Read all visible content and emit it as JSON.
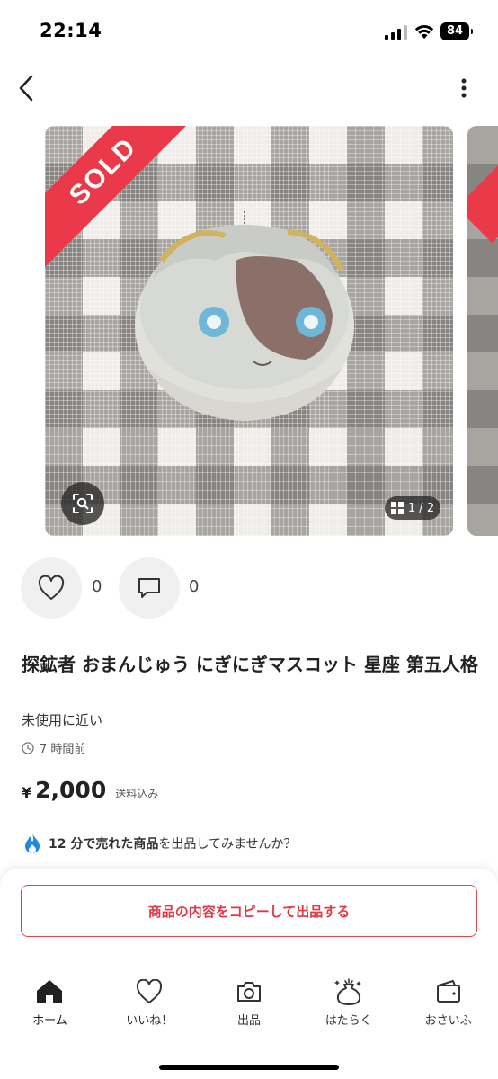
{
  "status_bar": {
    "time": "22:14",
    "battery": "84"
  },
  "header": {
    "back_icon": "chevron-left-icon",
    "more_icon": "more-vertical-icon"
  },
  "gallery": {
    "sold_label": "SOLD",
    "page_indicator": "1 / 2",
    "zoom_icon": "image-search-icon",
    "grid_icon": "grid-icon"
  },
  "actions": {
    "like_count": "0",
    "comment_count": "0"
  },
  "product": {
    "title": "探鉱者 おまんじゅう にぎにぎマスコット 星座 第五人格",
    "condition": "未使用に近い",
    "posted_time": "7 時間前",
    "price_symbol": "¥",
    "price": "2,000",
    "shipping": "送料込み"
  },
  "promo": {
    "highlight": "12 分で売れた商品",
    "text": "を出品してみませんか？"
  },
  "bottom": {
    "copy_listing_label": "商品の内容をコピーして出品する"
  },
  "tabs": [
    {
      "label": "ホーム",
      "icon": "home-icon"
    },
    {
      "label": "いいね！",
      "icon": "heart-icon"
    },
    {
      "label": "出品",
      "icon": "camera-icon"
    },
    {
      "label": "はたらく",
      "icon": "money-bag-icon"
    },
    {
      "label": "おさいふ",
      "icon": "wallet-icon"
    }
  ],
  "colors": {
    "accent": "#e23744",
    "sold_banner": "#ea3a4a",
    "promo_icon": "#1e88e5"
  }
}
